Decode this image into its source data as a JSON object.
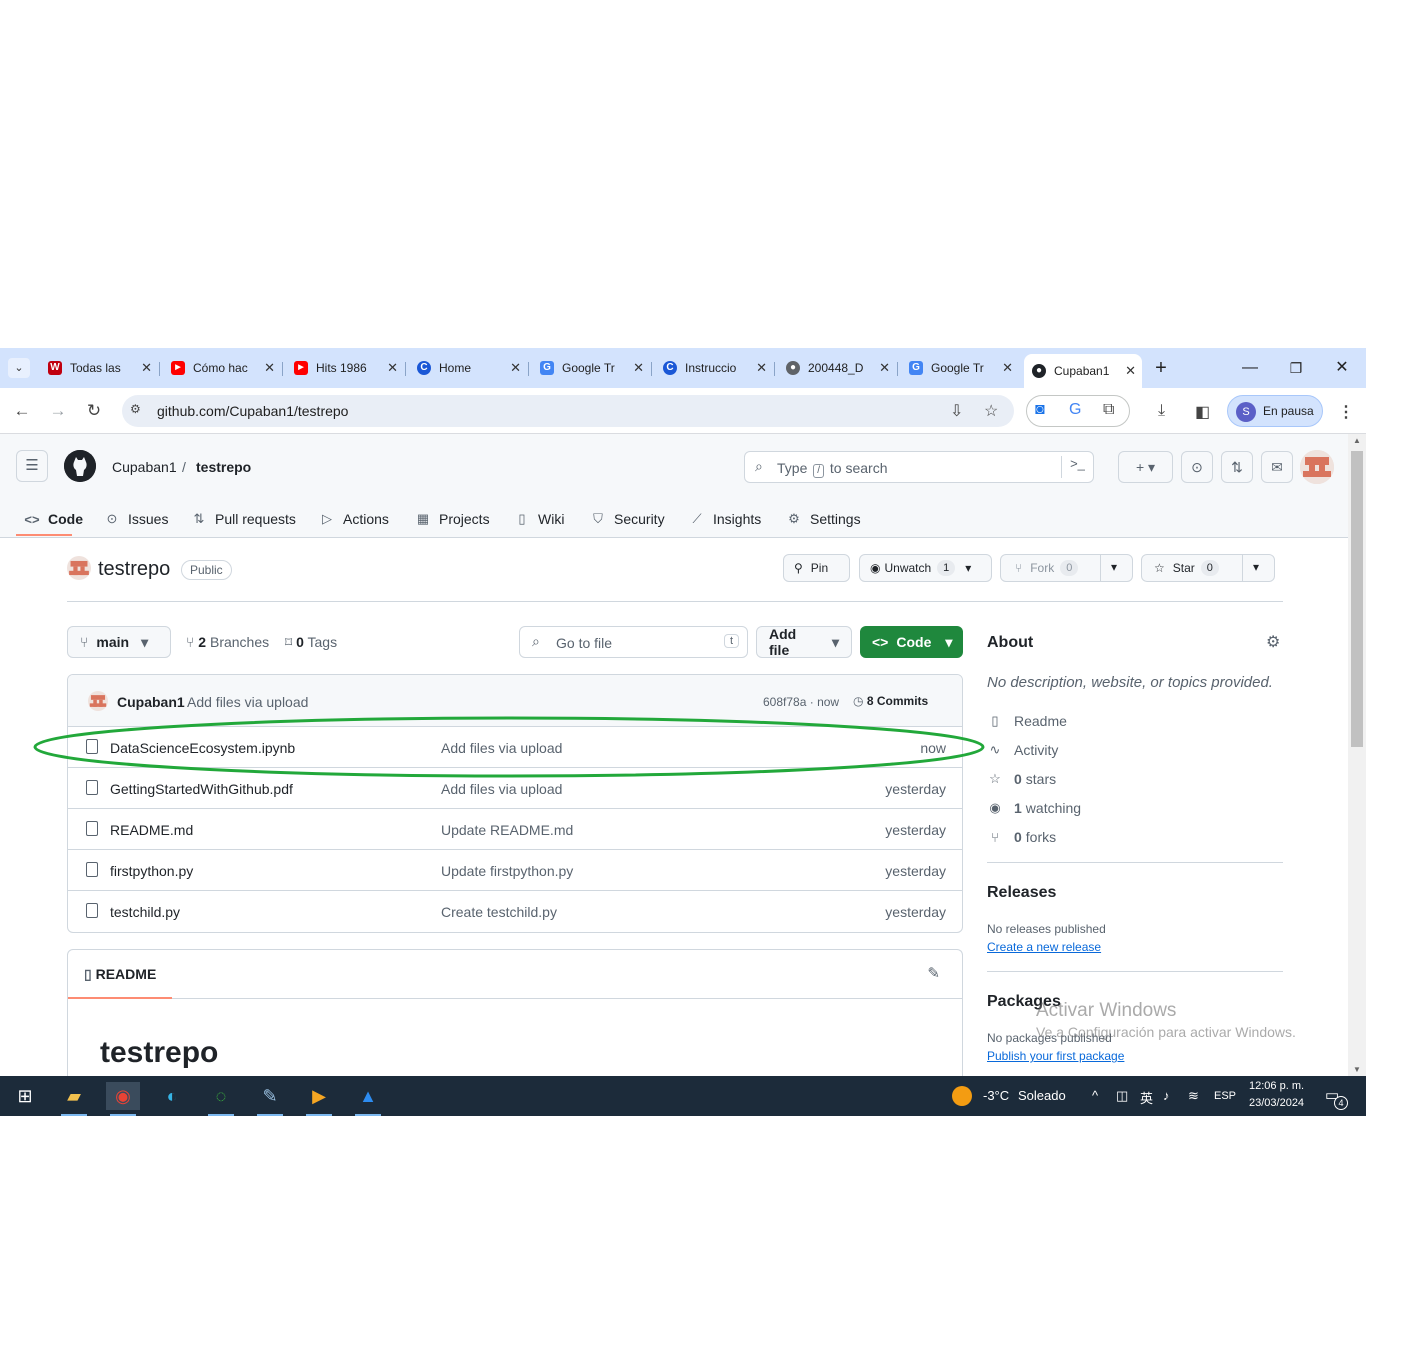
{
  "browser": {
    "tabs": [
      {
        "title": "Todas las",
        "fav": "W",
        "fav_color": "#c0000f"
      },
      {
        "title": "Cómo hac",
        "fav": "▶",
        "fav_color": "#ff0000"
      },
      {
        "title": "Hits 1986",
        "fav": "▶",
        "fav_color": "#ff0000"
      },
      {
        "title": "Home",
        "fav": "C",
        "fav_color": "#1a57d6"
      },
      {
        "title": "Google Tr",
        "fav": "G",
        "fav_color": "#4285f4"
      },
      {
        "title": "Instruccio",
        "fav": "C",
        "fav_color": "#1a57d6"
      },
      {
        "title": "200448_D",
        "fav": "●",
        "fav_color": "#5f6368"
      },
      {
        "title": "Google Tr",
        "fav": "G",
        "fav_color": "#4285f4"
      },
      {
        "title": "Cupaban1",
        "fav": "●",
        "fav_color": "#1f2328"
      }
    ],
    "new_tab": "+",
    "url": "github.com/Cupaban1/testrepo",
    "profile_initial": "S",
    "profile_label": "En pausa"
  },
  "github": {
    "owner": "Cupaban1",
    "separator": "/",
    "repo": "testrepo",
    "search_prefix": "Type",
    "search_key": "/",
    "search_suffix": "to search",
    "nav": [
      "Code",
      "Issues",
      "Pull requests",
      "Actions",
      "Projects",
      "Wiki",
      "Security",
      "Insights",
      "Settings"
    ],
    "visibility": "Public",
    "pin_label": "Pin",
    "unwatch_label": "Unwatch",
    "unwatch_count": "1",
    "fork_label": "Fork",
    "fork_count": "0",
    "star_label": "Star",
    "star_count": "0",
    "branch": "main",
    "branches_count": "2",
    "branches_label": "Branches",
    "tags_count": "0",
    "tags_label": "Tags",
    "goto_placeholder": "Go to file",
    "goto_key": "t",
    "add_file": "Add file",
    "code_btn": "Code",
    "latest_commit": {
      "author": "Cupaban1",
      "message": "Add files via upload",
      "sha": "608f78a",
      "age": "now",
      "commits_count": "8",
      "commits_label": "Commits"
    },
    "files": [
      {
        "name": "DataScienceEcosystem.ipynb",
        "message": "Add files via upload",
        "age": "now"
      },
      {
        "name": "GettingStartedWithGithub.pdf",
        "message": "Add files via upload",
        "age": "yesterday"
      },
      {
        "name": "README.md",
        "message": "Update README.md",
        "age": "yesterday"
      },
      {
        "name": "firstpython.py",
        "message": "Update firstpython.py",
        "age": "yesterday"
      },
      {
        "name": "testchild.py",
        "message": "Create testchild.py",
        "age": "yesterday"
      }
    ],
    "readme_tab": "README",
    "readme_title": "testrepo",
    "about": {
      "heading": "About",
      "description": "No description, website, or topics provided.",
      "readme": "Readme",
      "activity": "Activity",
      "stars_count": "0",
      "stars_label": "stars",
      "watching_count": "1",
      "watching_label": "watching",
      "forks_count": "0",
      "forks_label": "forks"
    },
    "releases": {
      "heading": "Releases",
      "text": "No releases published",
      "link": "Create a new release"
    },
    "packages": {
      "heading": "Packages",
      "text": "No packages published",
      "link": "Publish your first package"
    }
  },
  "watermark": {
    "line1": "Activar Windows",
    "line2": "Ve a Configuración para activar Windows."
  },
  "annotation": {
    "color": "#22a83a"
  },
  "taskbar": {
    "weather_temp": "-3°C",
    "weather_text": "Soleado",
    "language": "ESP",
    "time": "12:06 p. m.",
    "date": "23/03/2024",
    "notification_count": "4"
  }
}
